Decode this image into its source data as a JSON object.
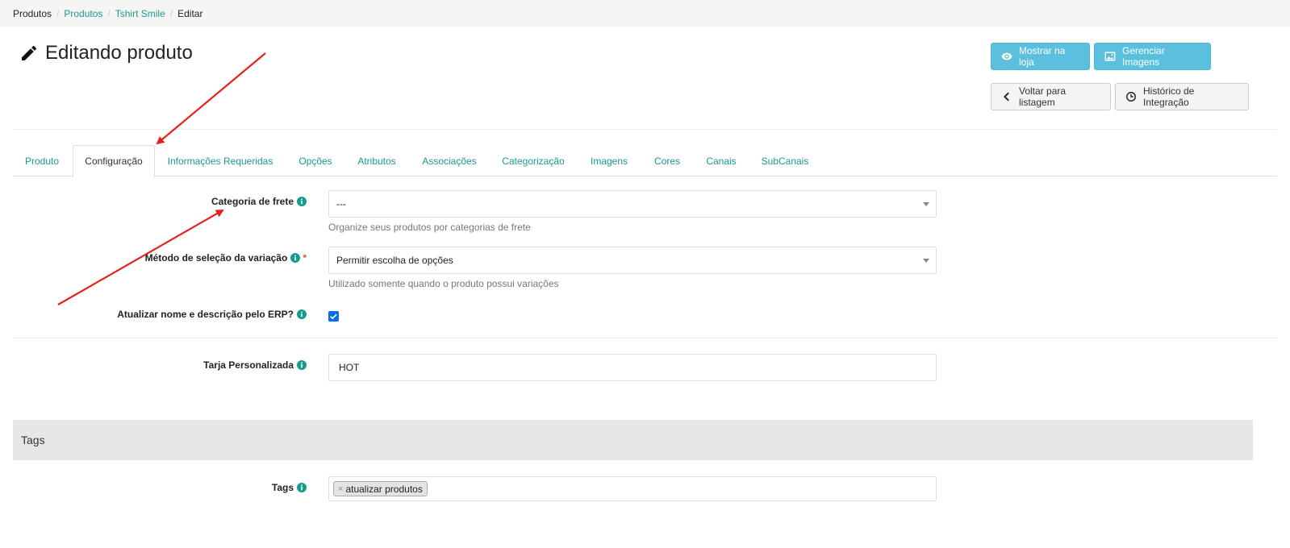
{
  "breadcrumb": [
    "Produtos",
    "Produtos",
    "Tshirt Smile",
    "Editar"
  ],
  "page": {
    "title": "Editando produto"
  },
  "buttons": {
    "show_store": "Mostrar na loja",
    "manage_images": "Gerenciar Imagens",
    "back_list": "Voltar para listagem",
    "history": "Histórico de Integração"
  },
  "tabs": [
    "Produto",
    "Configuração",
    "Informações Requeridas",
    "Opções",
    "Atributos",
    "Associações",
    "Categorização",
    "Imagens",
    "Cores",
    "Canais",
    "SubCanais"
  ],
  "active_tab": "Configuração",
  "form": {
    "shipping_category": {
      "label": "Categoria de frete",
      "value": "---",
      "help": "Organize seus produtos por categorias de frete"
    },
    "variation_method": {
      "label": "Método de seleção da variação",
      "required": "*",
      "value": "Permitir escolha de opções",
      "help": "Utilizado somente quando o produto possui variações"
    },
    "update_erp": {
      "label": "Atualizar nome e descrição pelo ERP?",
      "checked": true
    },
    "custom_stripe": {
      "label": "Tarja Personalizada",
      "value": "HOT"
    }
  },
  "tags_panel": {
    "title": "Tags",
    "label": "Tags",
    "items": [
      {
        "remove": "×",
        "text": "atualizar produtos"
      }
    ]
  },
  "colors": {
    "accent": "#1a9a8a",
    "info_button": "#5bc0de",
    "arrow": "#e8201c",
    "checkbox": "#0b6ee6"
  }
}
